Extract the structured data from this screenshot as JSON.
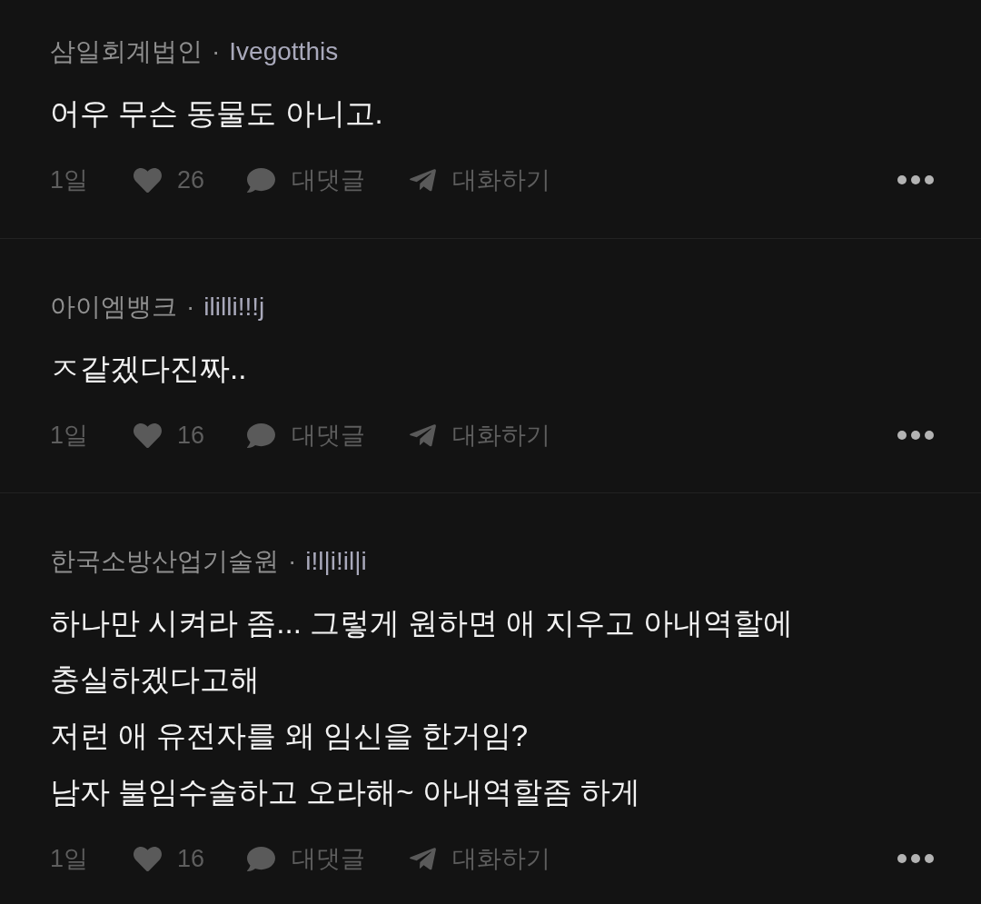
{
  "comments": [
    {
      "author": "삼일회계법인",
      "separator": "·",
      "handle": "Ivegotthis",
      "text": "어우 무슨 동물도 아니고.",
      "time": "1일",
      "likes": "26",
      "reply_label": "대댓글",
      "chat_label": "대화하기"
    },
    {
      "author": "아이엠뱅크",
      "separator": "·",
      "handle": "ililli!!!j",
      "text": "ㅈ같겠다진짜..",
      "time": "1일",
      "likes": "16",
      "reply_label": "대댓글",
      "chat_label": "대화하기"
    },
    {
      "author": "한국소방산업기술원",
      "separator": "·",
      "handle": "i!l|i!il|i",
      "text": "하나만 시켜라 좀... 그렇게 원하면 애 지우고 아내역할에 충실하겠다고해\n저런 애 유전자를 왜 임신을 한거임?\n남자 불임수술하고 오라해~ 아내역할좀 하게",
      "time": "1일",
      "likes": "16",
      "reply_label": "대댓글",
      "chat_label": "대화하기"
    }
  ]
}
